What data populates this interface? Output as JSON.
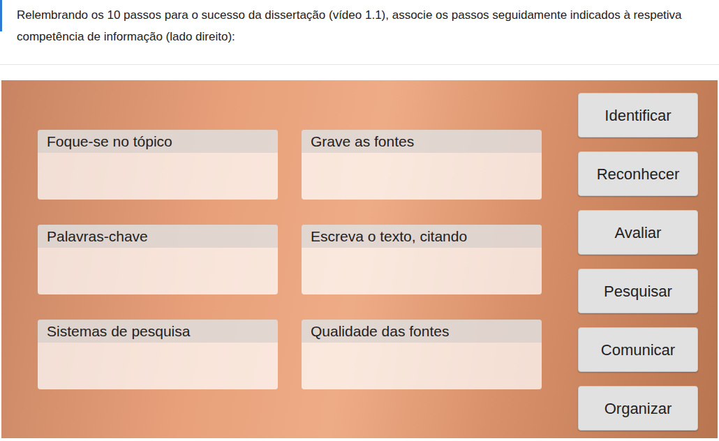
{
  "question": {
    "text": "Relembrando os 10 passos para o sucesso da dissertação (vídeo 1.1), associe os passos seguidamente indicados à respetiva competência de informação (lado direito):"
  },
  "drop_zones": [
    {
      "label": "Foque-se no tópico"
    },
    {
      "label": "Grave as fontes"
    },
    {
      "label": "Palavras-chave"
    },
    {
      "label": "Escreva o texto, citando"
    },
    {
      "label": "Sistemas de pesquisa"
    },
    {
      "label": "Qualidade das fontes"
    }
  ],
  "options": [
    {
      "label": "Identificar"
    },
    {
      "label": "Reconhecer"
    },
    {
      "label": "Avaliar"
    },
    {
      "label": "Pesquisar"
    },
    {
      "label": "Comunicar"
    },
    {
      "label": "Organizar"
    }
  ]
}
